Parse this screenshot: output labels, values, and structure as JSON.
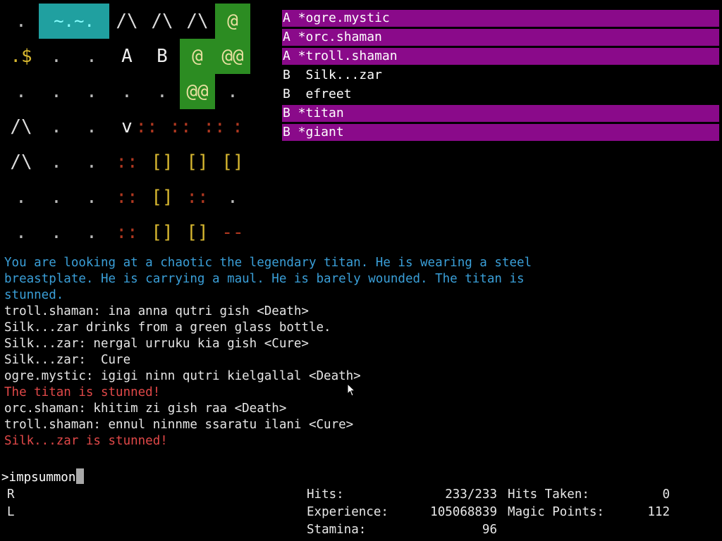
{
  "map": {
    "rows": [
      [
        ".",
        "~.~.",
        "",
        "/\\",
        "/\\",
        "/\\",
        "@",
        ""
      ],
      [
        ".$",
        ".",
        ".",
        "A",
        "B",
        "@",
        "@@",
        ""
      ],
      [
        ".",
        ".",
        ".",
        ".",
        ".",
        "@@",
        ".",
        ""
      ],
      [
        "/\\",
        ".",
        ".",
        "v",
        "::",
        "::",
        "::",
        ":"
      ],
      [
        "/\\",
        ".",
        ".",
        "::",
        "[]",
        "[]",
        "[]",
        ""
      ],
      [
        ".",
        ".",
        ".",
        "::",
        "[]",
        "::",
        ".",
        ""
      ],
      [
        ".",
        ".",
        ".",
        "::",
        "[]",
        "[]",
        "--",
        ""
      ]
    ]
  },
  "monsters": [
    {
      "text": "A *ogre.mystic",
      "highlight": true
    },
    {
      "text": "A *orc.shaman",
      "highlight": true
    },
    {
      "text": "A *troll.shaman",
      "highlight": true
    },
    {
      "text": "B  Silk...zar",
      "highlight": false
    },
    {
      "text": "B  efreet",
      "highlight": false
    },
    {
      "text": "B *titan",
      "highlight": true
    },
    {
      "text": "B *giant",
      "highlight": true
    }
  ],
  "log": [
    {
      "text": "You are looking at a chaotic the legendary titan. He is wearing a steel",
      "color": "#3a9fd8"
    },
    {
      "text": "breastplate. He is carrying a maul. He is barely wounded. The titan is",
      "color": "#3a9fd8"
    },
    {
      "text": "stunned.",
      "color": "#3a9fd8"
    },
    {
      "text": "troll.shaman: ina anna qutri gish <Death>",
      "color": "#e6e6e6"
    },
    {
      "text": "Silk...zar drinks from a green glass bottle.",
      "color": "#e6e6e6"
    },
    {
      "text": "Silk...zar: nergal urruku kia gish <Cure>",
      "color": "#e6e6e6"
    },
    {
      "text": "Silk...zar:  Cure",
      "color": "#e6e6e6"
    },
    {
      "text": "ogre.mystic: igigi ninn qutri kielgallal <Death>",
      "color": "#e6e6e6"
    },
    {
      "text": "The titan is stunned!",
      "color": "#e04848"
    },
    {
      "text": "orc.shaman: khitim zi gish raa <Death>",
      "color": "#e6e6e6"
    },
    {
      "text": "troll.shaman: ennul ninnme ssaratu ilani <Cure>",
      "color": "#e6e6e6"
    },
    {
      "text": "Silk...zar is stunned!",
      "color": "#e04848"
    }
  ],
  "command": {
    "prompt": ">",
    "value": "impsummon"
  },
  "status": {
    "r_label": "R",
    "l_label": "L",
    "hits_label": "Hits:",
    "hits_value": "233/233",
    "experience_label": "Experience:",
    "experience_value": "105068839",
    "stamina_label": "Stamina:",
    "stamina_value": "96",
    "hits_taken_label": "Hits Taken:",
    "hits_taken_value": "0",
    "magic_points_label": "Magic Points:",
    "magic_points_value": "112"
  },
  "colors": {
    "highlight_bg": "#8a0a8a",
    "water_bg": "#20a0a0",
    "grass_bg": "#2c8c22",
    "gold": "#d8b830",
    "dirt_red": "#b03820"
  }
}
